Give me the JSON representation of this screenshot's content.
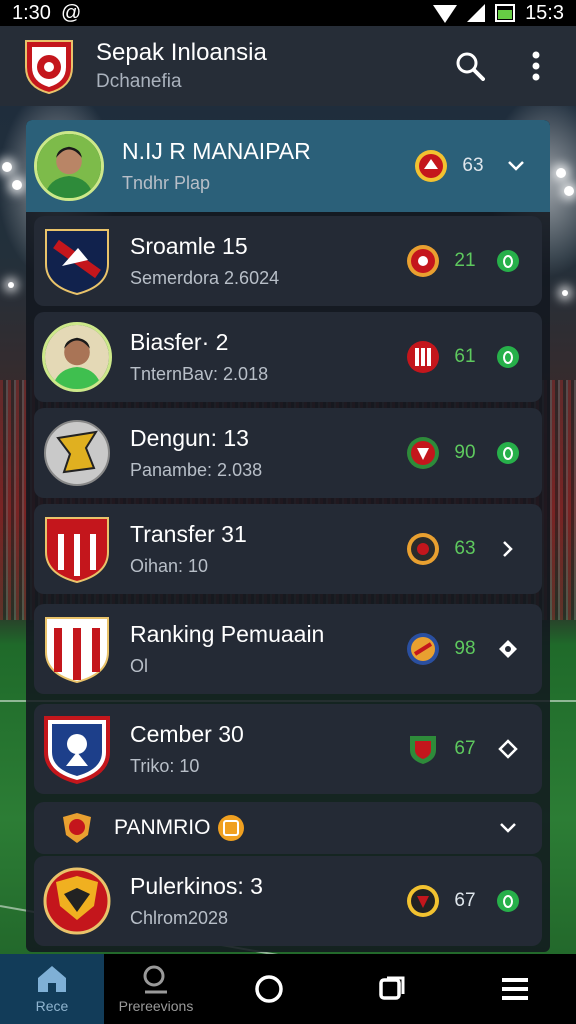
{
  "status_bar": {
    "time": "1:30",
    "at_symbol": "@",
    "right_time": "15:3"
  },
  "app_bar": {
    "title": "Sepak Inloansia",
    "subtitle": "Dchanefia",
    "search_icon": "search-icon",
    "menu_icon": "more-vert-icon"
  },
  "list": {
    "items": [
      {
        "title": "N.IJ R MANAIPAR",
        "subtitle": "Tndhr Plap",
        "score": "63",
        "score_color": "white",
        "action": "chevron-down-icon",
        "active": true
      },
      {
        "title": "Sroamle 15",
        "subtitle": "Semerdora 2.6024",
        "score": "21",
        "score_color": "green",
        "action": "green-dot-icon"
      },
      {
        "title": "Biasfer· 2",
        "subtitle": "TnternBav: 2.018",
        "score": "61",
        "score_color": "green",
        "action": "green-dot-icon"
      },
      {
        "title": "Dengun: 13",
        "subtitle": "Panambe: 2.038",
        "score": "90",
        "score_color": "green",
        "action": "green-dot-icon"
      },
      {
        "title": "Transfer 31",
        "subtitle": "Oihan: 10",
        "score": "63",
        "score_color": "green",
        "action": "chevron-right-icon"
      },
      {
        "title": "Ranking Pemuaain",
        "subtitle": "Ol",
        "score": "98",
        "score_color": "green",
        "action": "diamond-icon"
      },
      {
        "title": "Cember 30",
        "subtitle": "Triko: 10",
        "score": "67",
        "score_color": "green",
        "action": "diamond-icon"
      }
    ],
    "section": {
      "title": "PANMRIO",
      "action": "chevron-down-icon"
    },
    "last_item": {
      "title": "Pulerkinos: 3",
      "subtitle": "Chlrom2028",
      "score": "67",
      "score_color": "white",
      "action": "green-dot-icon"
    }
  },
  "bottom_nav": {
    "home_label": "Rece",
    "search_label": "Prereevions"
  },
  "colors": {
    "accent_active": "#2b6079",
    "score_green": "#5ec95e",
    "dot_green": "#27b04a",
    "card_bg": "#242a35",
    "appbar_bg": "#262d37"
  }
}
